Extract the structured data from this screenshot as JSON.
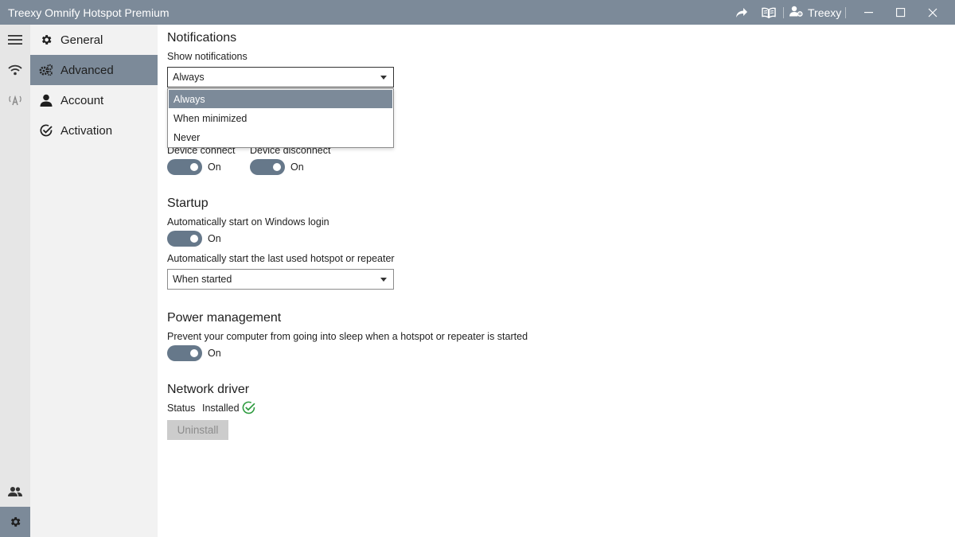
{
  "window": {
    "title": "Treexy Omnify Hotspot Premium",
    "user_name": "Treexy",
    "accent": "#7c8a99"
  },
  "nav": {
    "items": [
      {
        "label": "General",
        "icon": "gear-icon"
      },
      {
        "label": "Advanced",
        "icon": "gears-icon",
        "active": true
      },
      {
        "label": "Account",
        "icon": "person-icon"
      },
      {
        "label": "Activation",
        "icon": "check-circle-icon"
      }
    ]
  },
  "notifications": {
    "heading": "Notifications",
    "show_label": "Show notifications",
    "show_value": "Always",
    "options": [
      "Always",
      "When minimized",
      "Never"
    ],
    "device_connect_label": "Device connect",
    "device_connect_state": "On",
    "device_disconnect_label": "Device disconnect",
    "device_disconnect_state": "On"
  },
  "startup": {
    "heading": "Startup",
    "auto_start_label": "Automatically start on Windows login",
    "auto_start_state": "On",
    "last_hotspot_label": "Automatically start the last used hotspot or repeater",
    "last_hotspot_value": "When started"
  },
  "power": {
    "heading": "Power management",
    "prevent_sleep_label": "Prevent your computer from going into sleep when a hotspot or repeater is started",
    "prevent_sleep_state": "On"
  },
  "driver": {
    "heading": "Network driver",
    "status_label": "Status",
    "status_value": "Installed",
    "status_color": "#2e9b3f",
    "uninstall_label": "Uninstall"
  }
}
